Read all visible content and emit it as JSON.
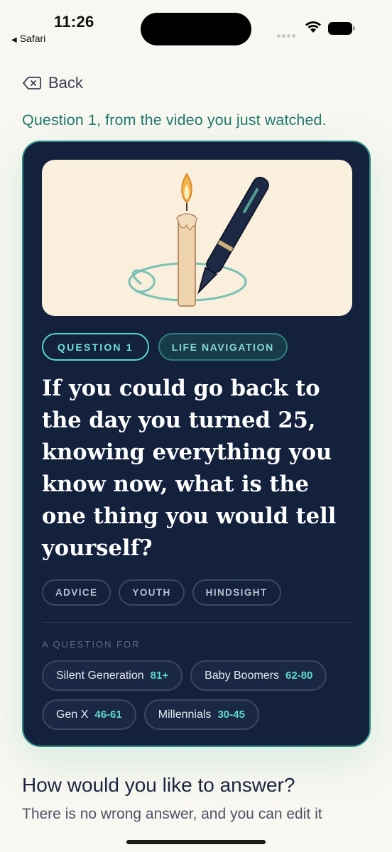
{
  "status_bar": {
    "time": "11:26",
    "back_app": "Safari"
  },
  "nav": {
    "back_label": "Back"
  },
  "intro": "Question 1, from the video you just watched.",
  "card": {
    "illustration_icon": "candle-and-pen-illustration",
    "tags": {
      "question": "QUESTION 1",
      "category": "LIFE NAVIGATION"
    },
    "question": "If you could go back to the day you turned 25, knowing everything you know now, what is the one thing you would tell yourself?",
    "topics": [
      "ADVICE",
      "YOUTH",
      "HINDSIGHT"
    ],
    "audience_label": "A QUESTION FOR",
    "generations": [
      {
        "name": "Silent Generation",
        "range": "81+"
      },
      {
        "name": "Baby Boomers",
        "range": "62-80"
      },
      {
        "name": "Gen X",
        "range": "46-61"
      },
      {
        "name": "Millennials",
        "range": "30-45"
      }
    ]
  },
  "answer": {
    "title": "How would you like to answer?",
    "subtitle": "There is no wrong answer, and you can edit it"
  },
  "colors": {
    "background": "#f9f7f1",
    "card": "#13213d",
    "accent_teal": "#1f7a6c",
    "tag_cyan": "#54d6cd"
  }
}
